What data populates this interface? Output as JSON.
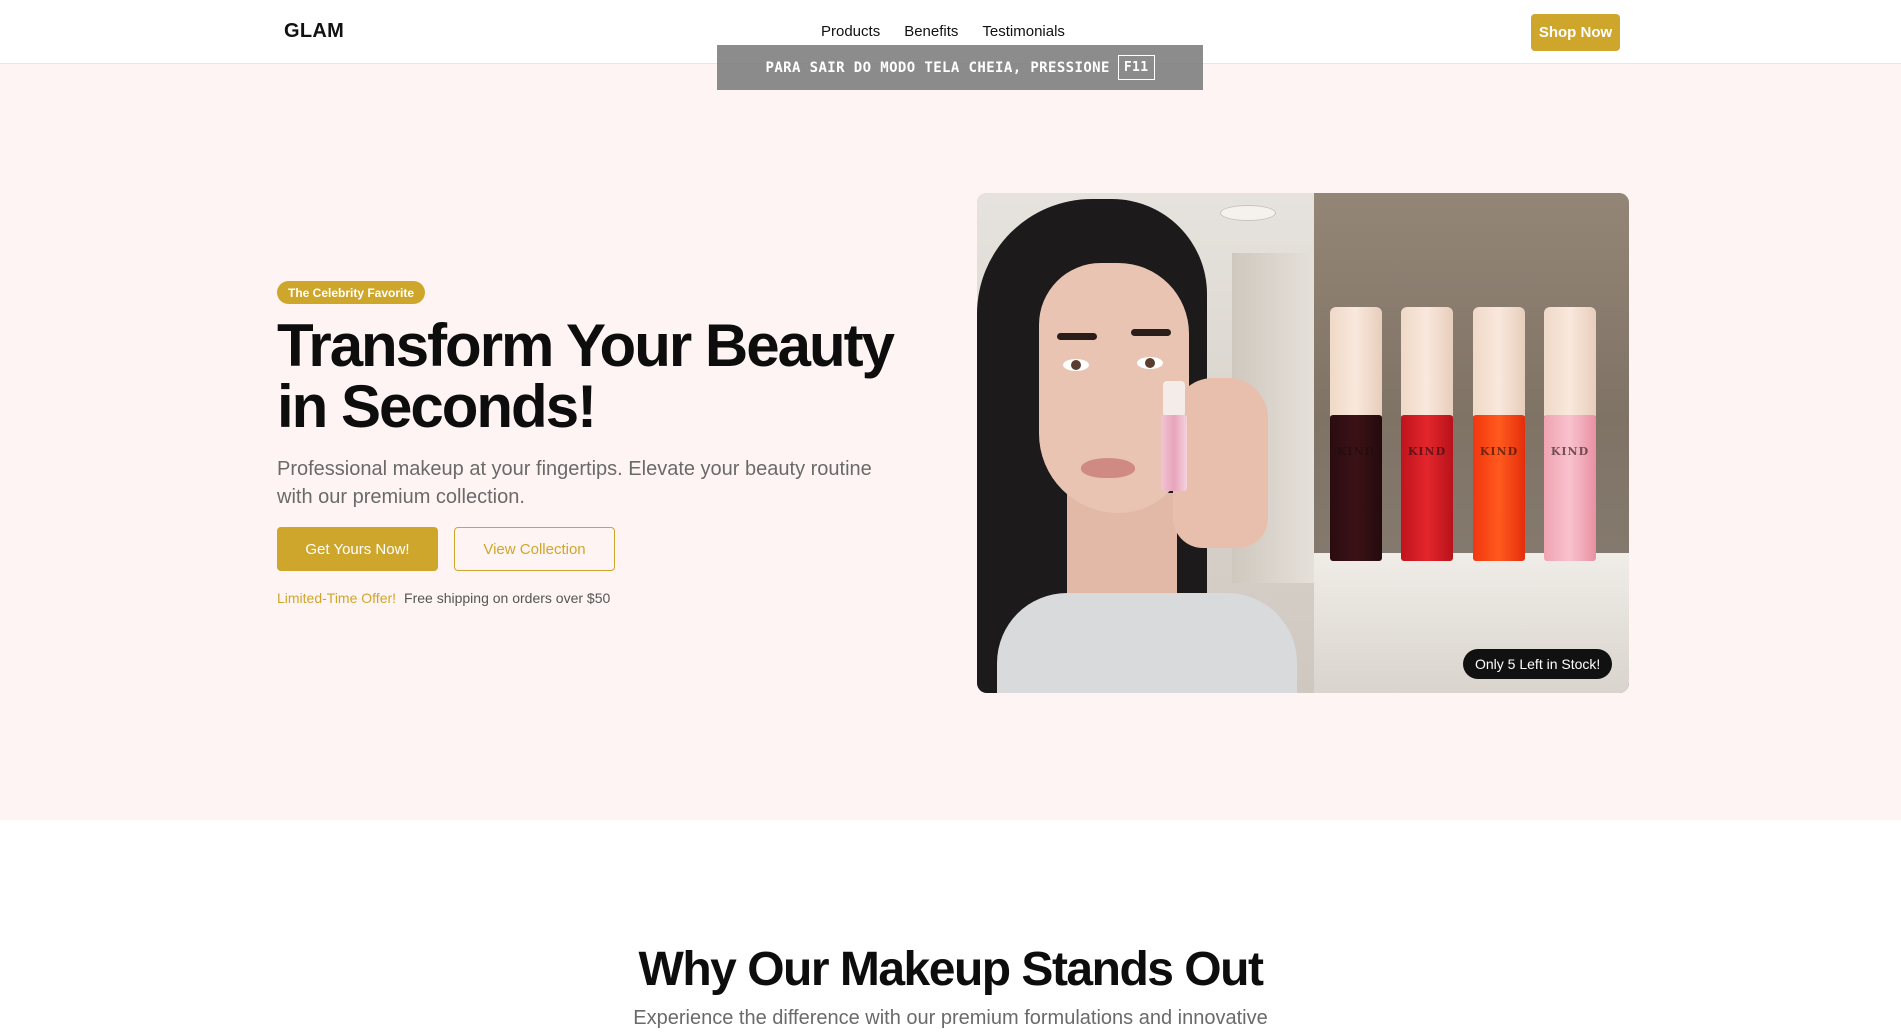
{
  "nav": {
    "logo": "GLAM",
    "links": [
      "Products",
      "Benefits",
      "Testimonials"
    ],
    "shop_button": "Shop Now"
  },
  "fullscreen_notice": {
    "text": "PARA SAIR DO MODO TELA CHEIA, PRESSIONE",
    "key": "F11"
  },
  "hero": {
    "badge": "The Celebrity Favorite",
    "headline": "Transform Your Beauty in Seconds!",
    "subheadline": "Professional makeup at your fingertips. Elevate your beauty routine with our premium collection.",
    "primary_cta": "Get Yours Now!",
    "secondary_cta": "View Collection",
    "offer_tag": "Limited-Time Offer!",
    "offer_text": "Free shipping on orders over $50",
    "stock_badge": "Only 5 Left in Stock!",
    "bottle_brand": "KIND"
  },
  "features": {
    "title": "Why Our Makeup Stands Out",
    "subtitle": "Experience the difference with our premium formulations and innovative"
  },
  "colors": {
    "accent": "#cfa62c",
    "hero_bg": "#fff4f4",
    "text_dark": "#0d0d0d",
    "text_muted": "#6a6a6a"
  }
}
